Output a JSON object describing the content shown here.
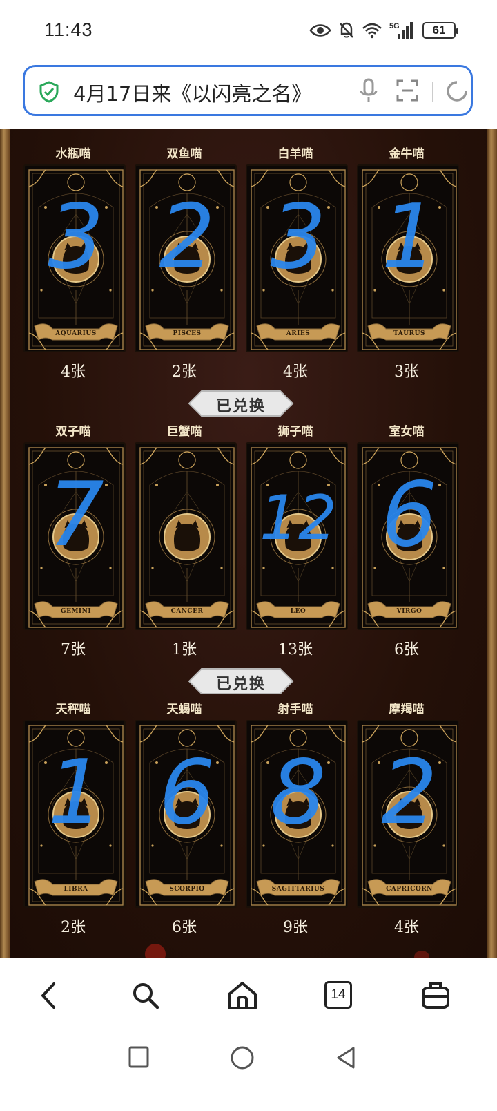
{
  "status_bar": {
    "time": "11:43",
    "network": "5G",
    "battery": "61"
  },
  "address_bar": {
    "text": "4月17日来《以闪亮之名》"
  },
  "zodiac_rows": [
    {
      "cells": [
        {
          "name": "水瓶喵",
          "sign": "AQUARIUS",
          "count": "4张",
          "mark": "3"
        },
        {
          "name": "双鱼喵",
          "sign": "PISCES",
          "count": "2张",
          "mark": "2"
        },
        {
          "name": "白羊喵",
          "sign": "ARIES",
          "count": "4张",
          "mark": "3"
        },
        {
          "name": "金牛喵",
          "sign": "TAURUS",
          "count": "3张",
          "mark": "1"
        }
      ],
      "button": "已兑换"
    },
    {
      "cells": [
        {
          "name": "双子喵",
          "sign": "GEMINI",
          "count": "7张",
          "mark": "7"
        },
        {
          "name": "巨蟹喵",
          "sign": "CANCER",
          "count": "1张",
          "mark": ""
        },
        {
          "name": "狮子喵",
          "sign": "LEO",
          "count": "13张",
          "mark": "12"
        },
        {
          "name": "室女喵",
          "sign": "VIRGO",
          "count": "6张",
          "mark": "6"
        }
      ],
      "button": "已兑换"
    },
    {
      "cells": [
        {
          "name": "天秤喵",
          "sign": "LIBRA",
          "count": "2张",
          "mark": "1"
        },
        {
          "name": "天蝎喵",
          "sign": "SCORPIO",
          "count": "6张",
          "mark": "6"
        },
        {
          "name": "射手喵",
          "sign": "SAGITTARIUS",
          "count": "9张",
          "mark": "8"
        },
        {
          "name": "摩羯喵",
          "sign": "CAPRICORN",
          "count": "4张",
          "mark": "2"
        }
      ]
    }
  ],
  "bottom_nav": {
    "tabs_count": "14"
  },
  "colors": {
    "accent": "#3a78e0",
    "page_bg": "#2a1410",
    "gold": "#c9a15a",
    "handwriting": "#2a86ec"
  }
}
